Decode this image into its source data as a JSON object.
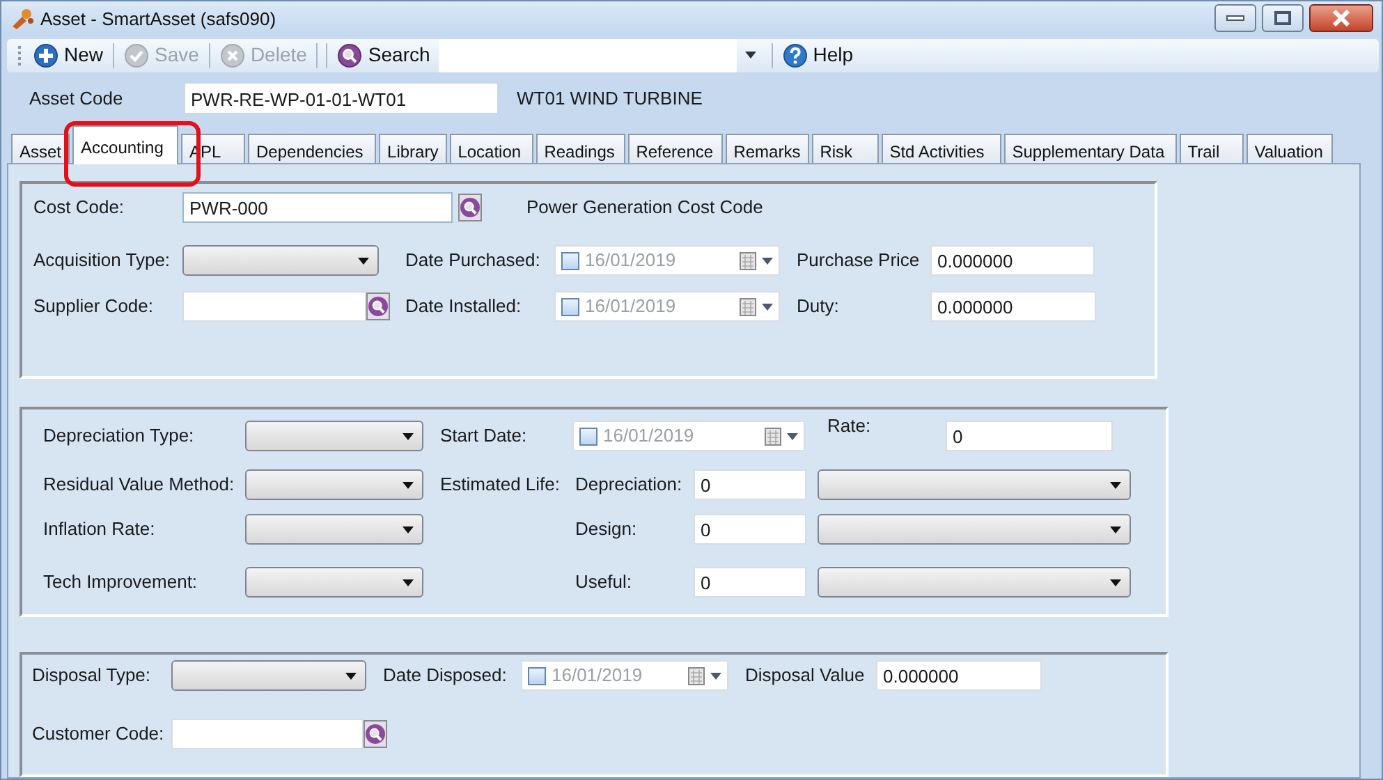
{
  "window": {
    "title": "Asset - SmartAsset (safs090)"
  },
  "toolbar": {
    "buttons": [
      {
        "label": "New",
        "kind": "new",
        "disabled": false
      },
      {
        "label": "Save",
        "kind": "save",
        "disabled": true
      },
      {
        "label": "Delete",
        "kind": "delete",
        "disabled": true
      },
      {
        "label": "Search",
        "kind": "search",
        "disabled": false
      }
    ],
    "help": {
      "label": "Help"
    }
  },
  "asset_code": {
    "label": "Asset Code",
    "value": "PWR-RE-WP-01-01-WT01",
    "description": "WT01 WIND TURBINE"
  },
  "tabs": [
    {
      "label": "Asset",
      "selected": false,
      "highlighted": false
    },
    {
      "label": "Accounting",
      "selected": true,
      "highlighted": true
    },
    {
      "label": "APL",
      "selected": false,
      "highlighted": false
    },
    {
      "label": "Dependencies",
      "selected": false,
      "highlighted": false
    },
    {
      "label": "Library",
      "selected": false,
      "highlighted": false
    },
    {
      "label": "Location",
      "selected": false,
      "highlighted": false
    },
    {
      "label": "Readings",
      "selected": false,
      "highlighted": false
    },
    {
      "label": "Reference",
      "selected": false,
      "highlighted": false
    },
    {
      "label": "Remarks",
      "selected": false,
      "highlighted": false
    },
    {
      "label": "Risk",
      "selected": false,
      "highlighted": false
    },
    {
      "label": "Std Activities",
      "selected": false,
      "highlighted": false
    },
    {
      "label": "Supplementary Data",
      "selected": false,
      "highlighted": false
    },
    {
      "label": "Trail",
      "selected": false,
      "highlighted": false
    },
    {
      "label": "Valuation",
      "selected": false,
      "highlighted": false
    }
  ],
  "sections": [
    {
      "rows": [
        [
          {
            "kind": "label",
            "text": "Cost Code:"
          },
          {
            "kind": "lookup",
            "value": "PWR-000"
          },
          {
            "kind": "gap"
          },
          {
            "kind": "text",
            "text": "Power Generation Cost Code"
          }
        ],
        [
          {
            "kind": "label",
            "text": "Acquisition Type:"
          },
          {
            "kind": "combo"
          },
          {
            "kind": "label",
            "text": "Date Purchased:"
          },
          {
            "kind": "date",
            "value": "16/01/2019",
            "checked": false
          },
          {
            "kind": "label",
            "text": "Purchase Price"
          },
          {
            "kind": "field",
            "value": "0.000000"
          }
        ],
        [
          {
            "kind": "label",
            "text": "Supplier Code:"
          },
          {
            "kind": "lookup"
          },
          {
            "kind": "label",
            "text": "Date Installed:"
          },
          {
            "kind": "date",
            "value": "16/01/2019",
            "checked": false
          },
          {
            "kind": "label",
            "text": "Duty:"
          },
          {
            "kind": "field",
            "value": "0.000000"
          }
        ]
      ]
    },
    {
      "rows": [
        [
          {
            "kind": "label",
            "text": "Depreciation Type:"
          },
          {
            "kind": "combo"
          },
          {
            "kind": "label",
            "text": "Start Date:"
          },
          {
            "kind": "date",
            "value": "16/01/2019",
            "checked": false
          },
          {
            "kind": "label",
            "text": "Rate:"
          },
          {
            "kind": "field",
            "value": "0"
          }
        ],
        [
          {
            "kind": "label",
            "text": "Residual Value Method:"
          },
          {
            "kind": "combo"
          },
          {
            "kind": "label",
            "text": "Estimated Life:"
          },
          {
            "kind": "label",
            "text": "Depreciation:"
          },
          {
            "kind": "field",
            "value": "0"
          },
          {
            "kind": "combo"
          }
        ],
        [
          {
            "kind": "label",
            "text": "Inflation Rate:"
          },
          {
            "kind": "combo"
          },
          {
            "kind": "gap"
          },
          {
            "kind": "label",
            "text": "Design:"
          },
          {
            "kind": "field",
            "value": "0"
          },
          {
            "kind": "combo"
          }
        ],
        [
          {
            "kind": "label",
            "text": "Tech Improvement:"
          },
          {
            "kind": "combo"
          },
          {
            "kind": "gap"
          },
          {
            "kind": "label",
            "text": "Useful:"
          },
          {
            "kind": "field",
            "value": "0"
          },
          {
            "kind": "combo"
          }
        ]
      ]
    },
    {
      "rows": [
        [
          {
            "kind": "label",
            "text": "Disposal Type:"
          },
          {
            "kind": "combo"
          },
          {
            "kind": "label",
            "text": "Date Disposed:"
          },
          {
            "kind": "date",
            "value": "16/01/2019",
            "checked": false
          },
          {
            "kind": "label",
            "text": "Disposal Value"
          },
          {
            "kind": "field",
            "value": "0.000000"
          }
        ],
        [
          {
            "kind": "label",
            "text": "Customer Code:"
          },
          {
            "kind": "lookup"
          }
        ]
      ]
    }
  ]
}
